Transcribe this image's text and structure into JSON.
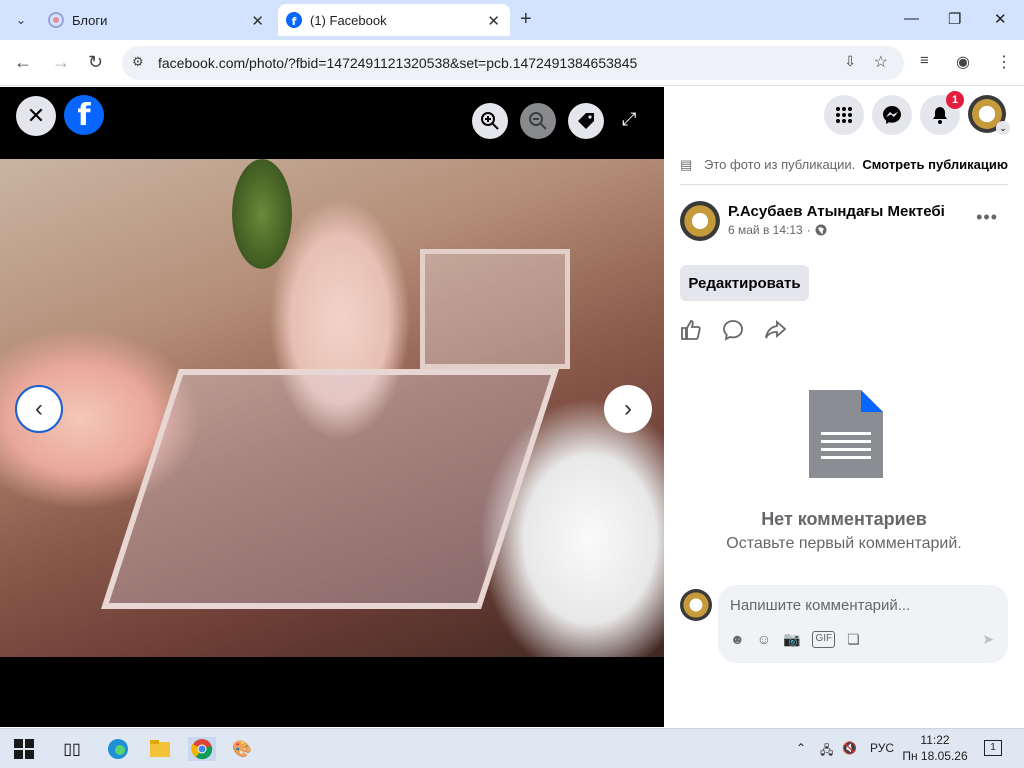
{
  "browser": {
    "tabs": [
      {
        "title": "Блоги",
        "active": false
      },
      {
        "title": "(1) Facebook",
        "active": true
      }
    ],
    "url": "facebook.com/photo/?fbid=1472491121320538&set=pcb.1472491384653845"
  },
  "viewer": {
    "close_icon": "close-icon",
    "logo": "facebook-logo-icon",
    "logo_letter": "f",
    "tools": [
      "zoom-in-icon",
      "zoom-out-icon",
      "tag-icon",
      "fullscreen-icon"
    ]
  },
  "panel": {
    "notif_count": "1",
    "publication_note": "Это фото из публикации.",
    "view_publication": "Смотреть публикацию",
    "author": "Р.Асубаев Атындағы Мектебі",
    "date": "6 май в 14:13",
    "date_separator": "·",
    "edit_label": "Редактировать",
    "no_comments_title": "Нет комментариев",
    "no_comments_subtitle": "Оставьте первый комментарий.",
    "comment_placeholder": "Напишите комментарий..."
  },
  "taskbar": {
    "lang": "РУС",
    "time": "11:22",
    "date": "Пн 18.05.26",
    "notif_count": "1"
  },
  "colors": {
    "brand": "#0866ff",
    "badge": "#e41e3f",
    "button_bg": "#e4e6eb"
  }
}
